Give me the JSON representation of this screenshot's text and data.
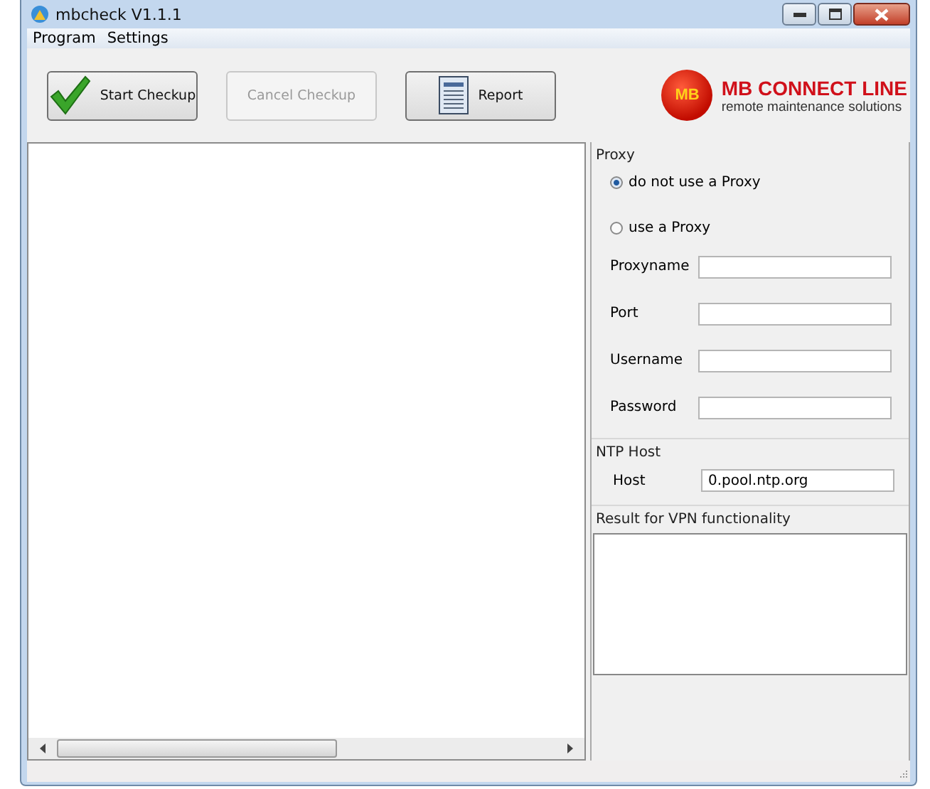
{
  "window": {
    "title": "mbcheck V1.1.1"
  },
  "menu": [
    "Program",
    "Settings"
  ],
  "toolbar": [
    {
      "kind": "check",
      "label": "Start Checkup",
      "disabled": false
    },
    {
      "kind": "none",
      "label": "Cancel Checkup",
      "disabled": true
    },
    {
      "kind": "report",
      "label": "Report",
      "disabled": false
    }
  ],
  "logo": {
    "badge": "MB",
    "name": "MB CONNECT LINE",
    "tagline": "remote maintenance solutions"
  },
  "proxy": {
    "title": "Proxy",
    "options": [
      {
        "label": "do not use a Proxy",
        "selected": true
      },
      {
        "label": "use a Proxy",
        "selected": false
      }
    ],
    "fields": [
      {
        "label": "Proxyname"
      },
      {
        "label": "Port"
      },
      {
        "label": "Username"
      },
      {
        "label": "Password"
      }
    ]
  },
  "ntp": {
    "title": "NTP Host",
    "label": "Host",
    "value": "0.pool.ntp.org"
  },
  "result": {
    "title": "Result for VPN functionality"
  }
}
